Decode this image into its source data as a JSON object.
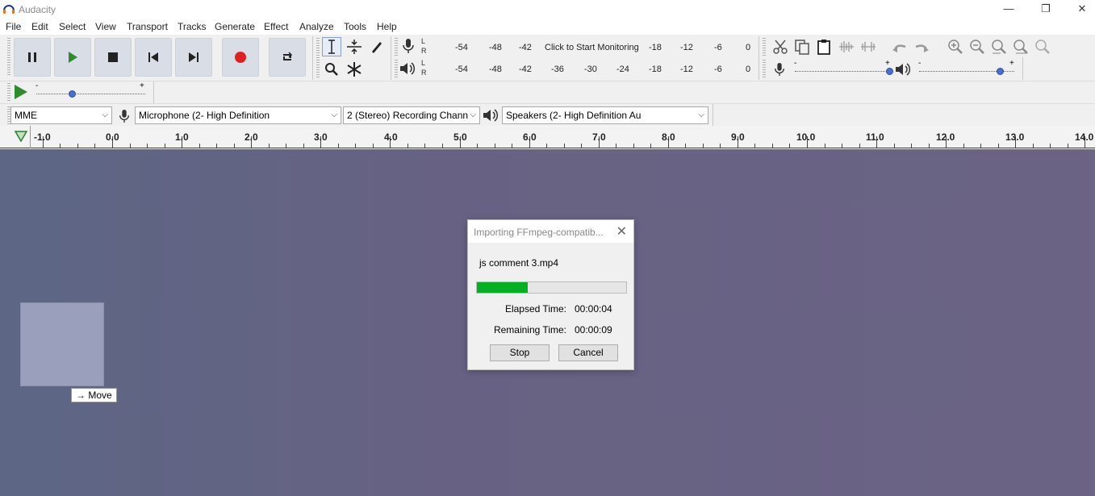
{
  "window": {
    "title": "Audacity",
    "minimize_glyph": "—",
    "restore_glyph": "❐",
    "close_glyph": "✕"
  },
  "menu": [
    "File",
    "Edit",
    "Select",
    "View",
    "Transport",
    "Tracks",
    "Generate",
    "Effect",
    "Analyze",
    "Tools",
    "Help"
  ],
  "meters": {
    "record_ticks": [
      "-54",
      "-48",
      "-42",
      "Click to Start Monitoring",
      "-18",
      "-12",
      "-6",
      "0"
    ],
    "play_ticks": [
      "-54",
      "-48",
      "-42",
      "-36",
      "-30",
      "-24",
      "-18",
      "-12",
      "-6",
      "0"
    ],
    "left_label": "L",
    "right_label": "R"
  },
  "sliders": {
    "minus": "-",
    "plus": "+"
  },
  "devices": {
    "host": "MME",
    "recording_device": "Microphone (2- High Definition",
    "channels": "2 (Stereo) Recording Chann",
    "playback_device": "Speakers (2- High Definition Au"
  },
  "ruler": {
    "labels": [
      "-1.0",
      "0.0",
      "1.0",
      "2.0",
      "3.0",
      "4.0",
      "5.0",
      "6.0",
      "7.0",
      "8.0",
      "9.0",
      "10.0",
      "11.0",
      "12.0",
      "13.0",
      "14.0"
    ]
  },
  "drag": {
    "tooltip": "Move",
    "arrow": "→"
  },
  "dialog": {
    "title": "Importing FFmpeg-compatib...",
    "filename": "js comment 3.mp4",
    "progress_percent": 34,
    "elapsed_label": "Elapsed Time:",
    "elapsed_value": "00:00:04",
    "remaining_label": "Remaining Time:",
    "remaining_value": "00:00:09",
    "stop_label": "Stop",
    "cancel_label": "Cancel",
    "close_glyph": "✕"
  },
  "colors": {
    "progress": "#06b025",
    "track_bg": "#676283",
    "record_red": "#e02020",
    "play_green": "#2e8b2e"
  }
}
